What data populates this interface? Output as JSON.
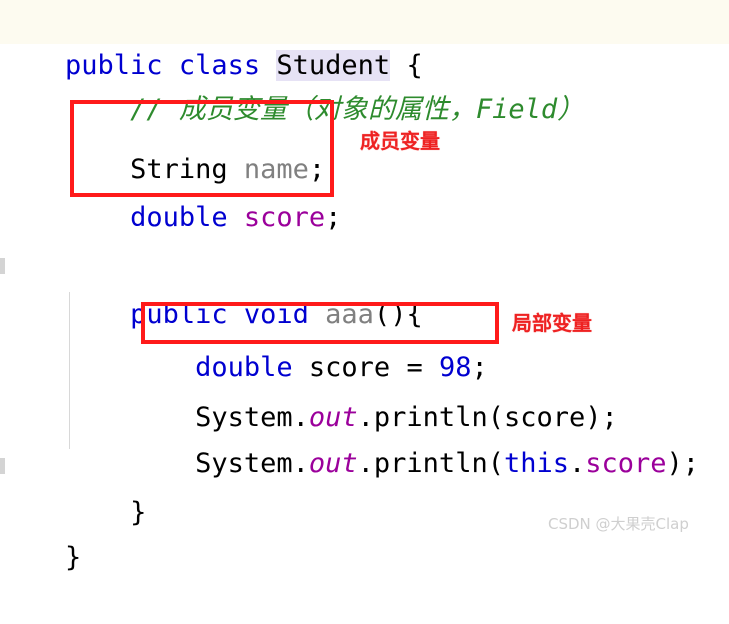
{
  "editor": {
    "background_color": "#ffffff",
    "current_line_color": "#fdfbf0",
    "occurrence_highlight_color": "#e6e2f5",
    "language": "java"
  },
  "colors": {
    "keyword": "#0000d0",
    "field": "#9b009b",
    "identifier": "#808080",
    "comment": "#2e8b2e",
    "number": "#0000d0",
    "punctuation": "#000000",
    "annotation_red": "#ee2222",
    "box_red": "#ff1a1a",
    "watermark_gray": "#cfcfcf"
  },
  "code": {
    "line1": {
      "kw_public": "public",
      "sp1": " ",
      "kw_class": "class",
      "sp2": " ",
      "name_student": "Student",
      "sp3": " ",
      "brace_open": "{"
    },
    "line2": {
      "indent": "    ",
      "comment": "// 成员变量（对象的属性，Field）"
    },
    "line3": {
      "indent": "    ",
      "type": "String",
      "sp1": " ",
      "name": "name",
      "semi": ";"
    },
    "line4": {
      "indent": "    ",
      "kw_double": "double",
      "sp1": " ",
      "field": "score",
      "semi": ";"
    },
    "line5": {
      "indent": "    ",
      "kw_public": "public",
      "sp1": " ",
      "kw_void": "void",
      "sp2": " ",
      "method": "aaa",
      "parens": "(){"
    },
    "line6": {
      "indent": "        ",
      "kw_double": "double",
      "sp1": " ",
      "var": "score",
      "sp2": " ",
      "eq": "=",
      "sp3": " ",
      "num": "98",
      "semi": ";"
    },
    "line7": {
      "indent": "        ",
      "system": "System.",
      "out": "out",
      "println_open": ".println(",
      "arg": "score",
      "close": ");"
    },
    "line8": {
      "indent": "        ",
      "system": "System.",
      "out": "out",
      "println_open": ".println(",
      "kw_this": "this",
      "dot": ".",
      "field": "score",
      "close": ");"
    },
    "line9": {
      "indent": "    ",
      "brace_close": "}"
    },
    "line10": {
      "brace_close": "}"
    }
  },
  "annotations": [
    {
      "id": "member-variable",
      "label": "成员变量",
      "target": "String name; double score;"
    },
    {
      "id": "local-variable",
      "label": "局部变量",
      "target": "double score = 98;"
    }
  ],
  "watermark": {
    "text": "CSDN @大果壳Clap"
  }
}
